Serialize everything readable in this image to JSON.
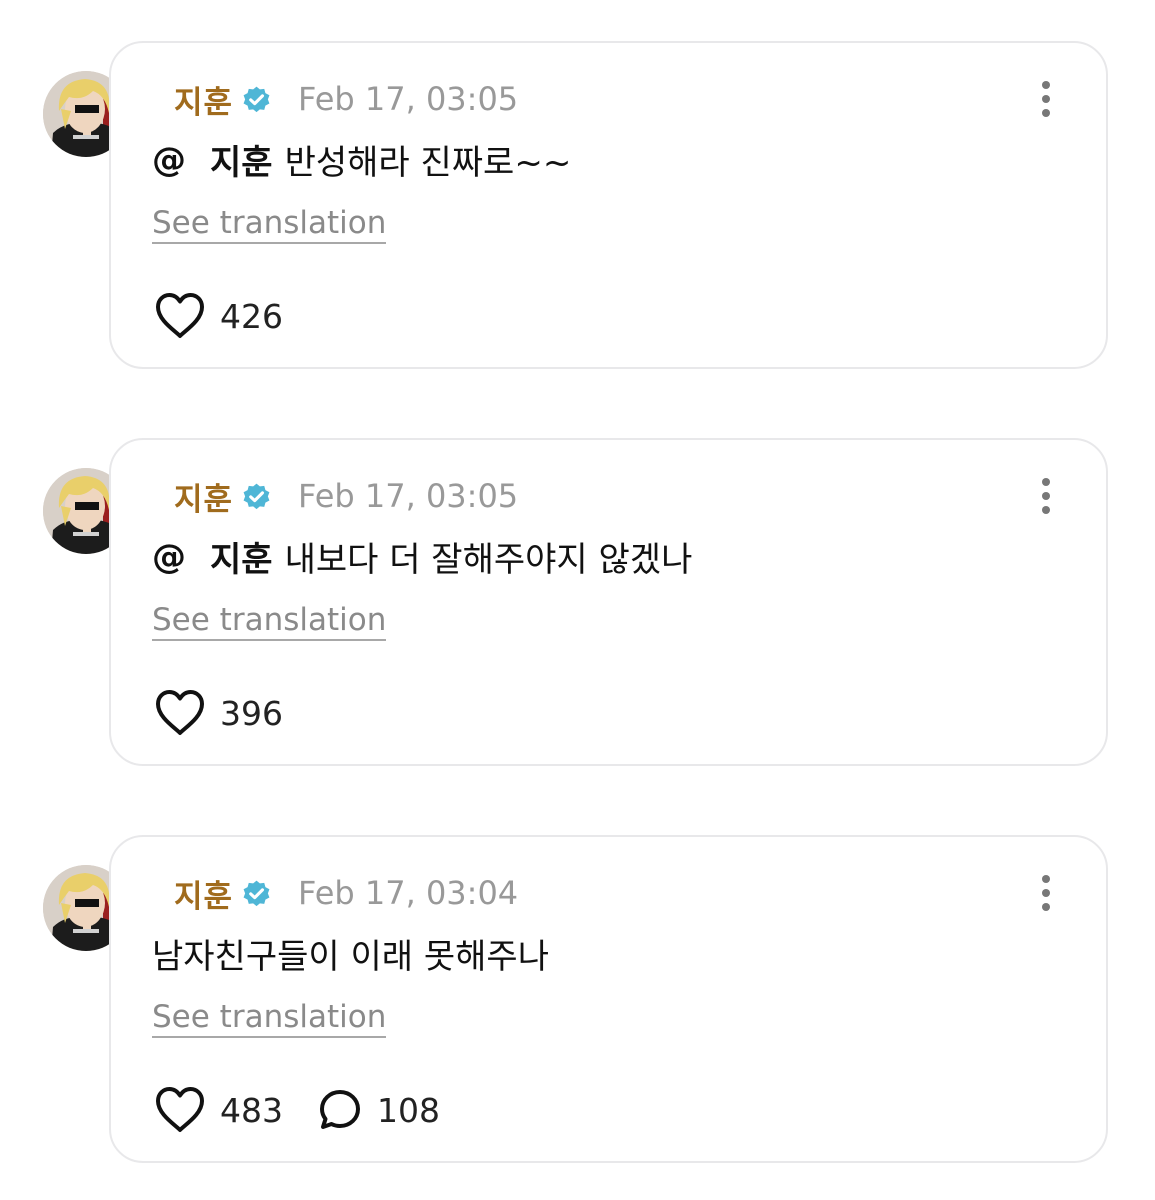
{
  "posts": [
    {
      "author": "지훈",
      "timestamp": "Feb 17, 03:05",
      "mention_at": "@",
      "mention_name": "지훈",
      "text": "반성해라 진짜로~~",
      "translate": "See translation",
      "likes": "426",
      "comments": ""
    },
    {
      "author": "지훈",
      "timestamp": "Feb 17, 03:05",
      "mention_at": "@",
      "mention_name": "지훈",
      "text": "내보다 더 잘해주야지 않겠나",
      "translate": "See translation",
      "likes": "396",
      "comments": ""
    },
    {
      "author": "지훈",
      "timestamp": "Feb 17, 03:04",
      "mention_at": "",
      "mention_name": "",
      "text": "남자친구들이 이래 못해주나",
      "translate": "See translation",
      "likes": "483",
      "comments": "108"
    }
  ],
  "icons": {
    "verified": "verified-badge-icon",
    "more": "more-vertical-icon",
    "like": "heart-icon",
    "comment": "comment-bubble-icon"
  },
  "colors": {
    "author": "#a06b1d",
    "verified": "#4fb6d6",
    "timestamp": "#999999",
    "card_border": "#e8e8ea"
  }
}
